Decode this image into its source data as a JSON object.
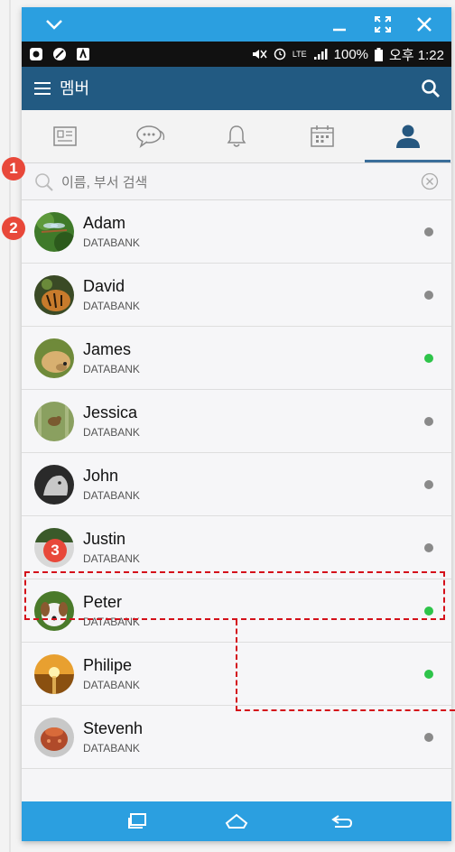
{
  "status_bar": {
    "battery": "100%",
    "time": "오후 1:22",
    "network": "LTE"
  },
  "app_bar": {
    "title": "멤버"
  },
  "tabs": [
    {
      "icon": "contact-card-icon",
      "active": false
    },
    {
      "icon": "chat-icon",
      "active": false
    },
    {
      "icon": "bell-icon",
      "active": false
    },
    {
      "icon": "calendar-icon",
      "active": false
    },
    {
      "icon": "person-icon",
      "active": true
    }
  ],
  "search": {
    "placeholder": "이름, 부서 검색",
    "value": ""
  },
  "members": [
    {
      "name": "Adam",
      "dept": "DATABANK",
      "status": "offline",
      "avatar": "dragonfly"
    },
    {
      "name": "David",
      "dept": "DATABANK",
      "status": "offline",
      "avatar": "tiger"
    },
    {
      "name": "James",
      "dept": "DATABANK",
      "status": "online",
      "avatar": "dog"
    },
    {
      "name": "Jessica",
      "dept": "DATABANK",
      "status": "offline",
      "avatar": "bird"
    },
    {
      "name": "John",
      "dept": "DATABANK",
      "status": "offline",
      "avatar": "wolf"
    },
    {
      "name": "Justin",
      "dept": "DATABANK",
      "status": "offline",
      "avatar": "bird2"
    },
    {
      "name": "Peter",
      "dept": "DATABANK",
      "status": "online",
      "avatar": "puppy"
    },
    {
      "name": "Philipe",
      "dept": "DATABANK",
      "status": "online",
      "avatar": "sunset"
    },
    {
      "name": "Stevenh",
      "dept": "DATABANK",
      "status": "offline",
      "avatar": "cake"
    }
  ],
  "colors": {
    "online": "#2ec44a",
    "offline": "#8a8a8a",
    "titlebar": "#2b9fe0",
    "appbar": "#225a82",
    "callout": "#e8483a",
    "highlight": "#d4101a"
  },
  "annotations": {
    "callout_1": "1",
    "callout_2": "2",
    "callout_3": "3"
  }
}
